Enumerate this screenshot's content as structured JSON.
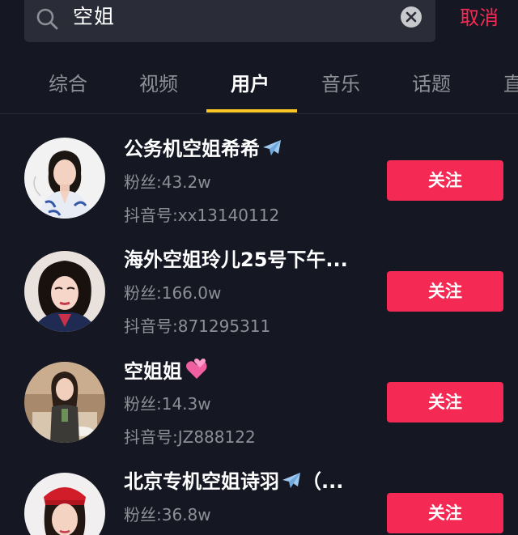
{
  "search": {
    "query": "空姐",
    "cancel_label": "取消"
  },
  "tabs": [
    {
      "label": "综合"
    },
    {
      "label": "视频"
    },
    {
      "label": "用户"
    },
    {
      "label": "音乐"
    },
    {
      "label": "话题"
    },
    {
      "label": "直"
    }
  ],
  "active_tab": "用户",
  "users": [
    {
      "name": "公务机空姐希希",
      "name_icon": "airplane-icon",
      "fans": "粉丝:43.2w",
      "douyin_id": "抖音号:xx13140112",
      "follow_label": "关注"
    },
    {
      "name": "海外空姐玲儿25号下午...",
      "fans": "粉丝:166.0w",
      "douyin_id": "抖音号:871295311",
      "follow_label": "关注"
    },
    {
      "name": "空姐姐",
      "name_icon": "two-hearts-icon",
      "fans": "粉丝:14.3w",
      "douyin_id": "抖音号:JZ888122",
      "follow_label": "关注"
    },
    {
      "name": "北京专机空姐诗羽",
      "name_icon": "airplane-icon",
      "name_suffix": "（...",
      "fans": "粉丝:36.8w",
      "follow_label": "关注"
    }
  ],
  "colors": {
    "background": "#151722",
    "search_bg": "#2a2c37",
    "accent": "#f52a54",
    "tab_indicator": "#f9c624",
    "muted_text": "#8e8f96"
  }
}
